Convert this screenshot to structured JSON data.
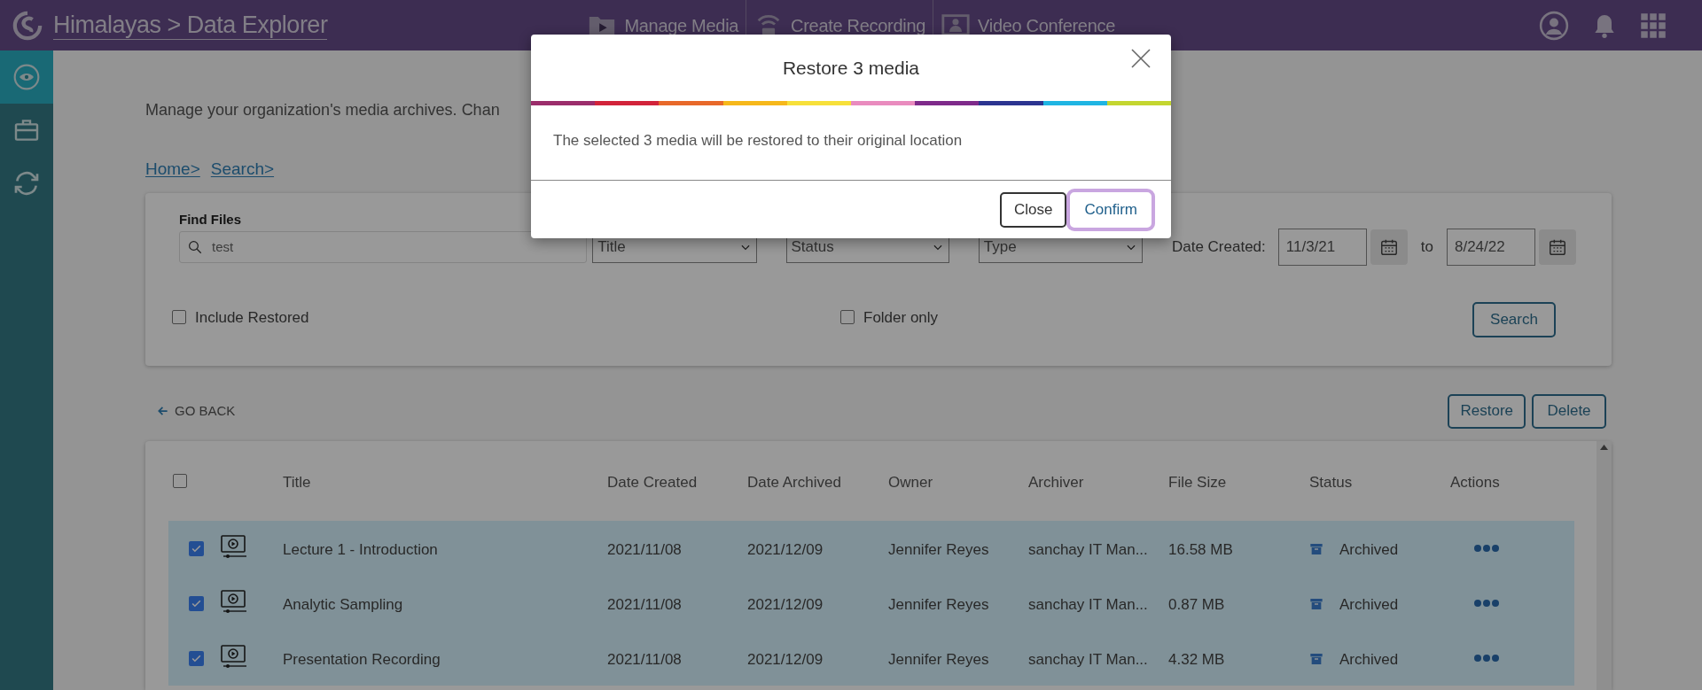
{
  "app_bar": {
    "title": "Himalayas > Data Explorer",
    "nav": [
      {
        "label": "Manage Media",
        "kind": "media"
      },
      {
        "label": "Create Recording",
        "kind": "recording"
      },
      {
        "label": "Video Conference",
        "kind": "conference"
      }
    ]
  },
  "sidebar": {
    "items": [
      {
        "kind": "eye",
        "selected": true
      },
      {
        "kind": "briefcase",
        "selected": false
      },
      {
        "kind": "sync",
        "selected": false
      }
    ]
  },
  "description": "Manage your organization's media archives. Chan",
  "breadcrumb": [
    "Home>",
    "Search>"
  ],
  "filters": {
    "label": "Find Files",
    "search": {
      "value": "test"
    },
    "selects": [
      {
        "value": "Title"
      },
      {
        "value": "Status"
      },
      {
        "value": "Type"
      }
    ],
    "date_label": "Date Created:",
    "date_from": "11/3/21",
    "to_label": "to",
    "date_to": "8/24/22",
    "checkboxes": [
      {
        "label": "Include Restored",
        "checked": false
      },
      {
        "label": "Folder only",
        "checked": false
      }
    ],
    "search_button": "Search"
  },
  "go_back": "GO BACK",
  "actions": [
    "Restore",
    "Delete"
  ],
  "table": {
    "select_all": {
      "checked": false
    },
    "columns": [
      "Title",
      "Date Created",
      "Date Archived",
      "Owner",
      "Archiver",
      "File Size",
      "Status",
      "Actions"
    ],
    "rows": [
      {
        "selected": true,
        "title": "Lecture 1 - Introduction",
        "date_created": "2021/11/08",
        "date_archived": "2021/12/09",
        "owner": "Jennifer Reyes",
        "archiver": "sanchay IT Man...",
        "file_size": "16.58 MB",
        "status": "Archived"
      },
      {
        "selected": true,
        "title": "Analytic Sampling",
        "date_created": "2021/11/08",
        "date_archived": "2021/12/09",
        "owner": "Jennifer Reyes",
        "archiver": "sanchay IT Man...",
        "file_size": "0.87 MB",
        "status": "Archived"
      },
      {
        "selected": true,
        "title": "Presentation Recording",
        "date_created": "2021/11/08",
        "date_archived": "2021/12/09",
        "owner": "Jennifer Reyes",
        "archiver": "sanchay IT Man...",
        "file_size": "4.32 MB",
        "status": "Archived"
      }
    ]
  },
  "dialog": {
    "title": "Restore 3 media",
    "message": "The selected 3 media will be restored to their original location",
    "buttons": [
      {
        "label": "Close",
        "kind": "secondary",
        "focused": false
      },
      {
        "label": "Confirm",
        "kind": "primary",
        "focused": true
      }
    ]
  }
}
